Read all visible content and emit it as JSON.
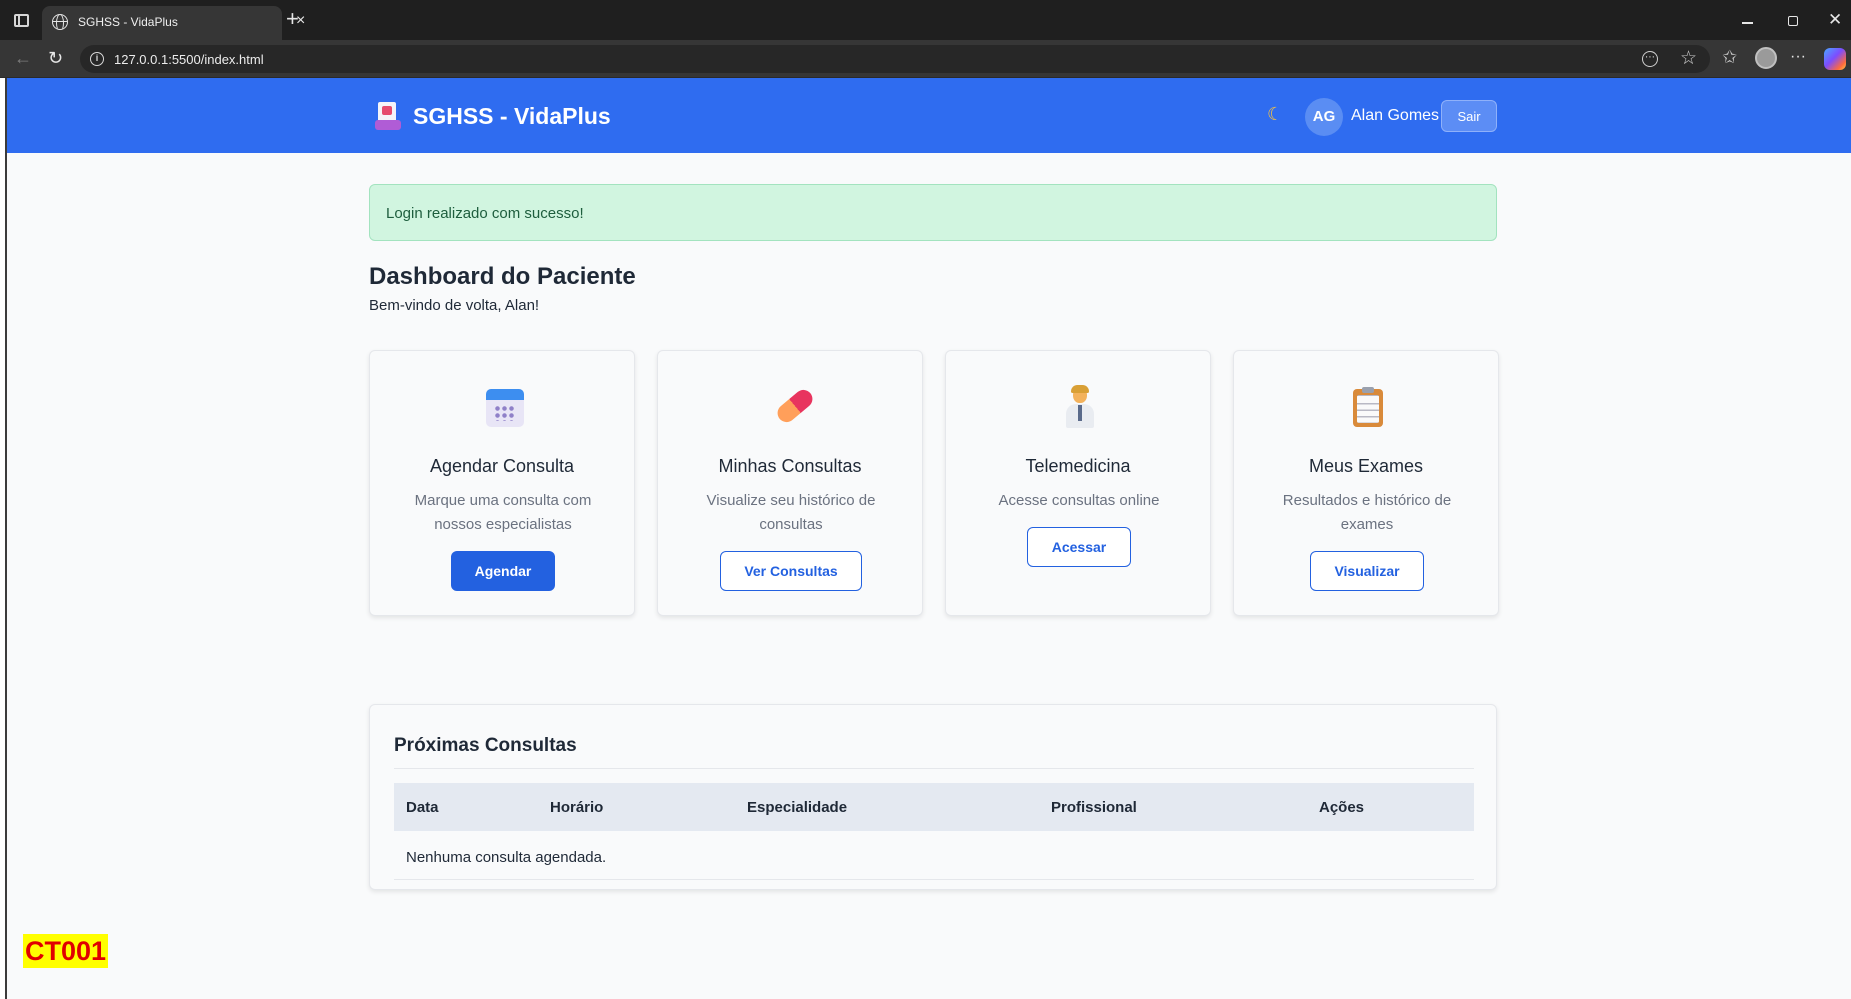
{
  "browser": {
    "tab_title": "SGHSS - VidaPlus",
    "tab_close": "×",
    "new_tab": "+",
    "url": "127.0.0.1:5500/index.html"
  },
  "header": {
    "brand": "SGHSS - VidaPlus",
    "theme_icon": "☾",
    "avatar_initials": "AG",
    "user_name": "Alan Gomes",
    "logout_label": "Sair"
  },
  "alert": {
    "message": "Login realizado com sucesso!"
  },
  "dashboard": {
    "title": "Dashboard do Paciente",
    "subtitle": "Bem-vindo de volta, Alan!"
  },
  "cards": [
    {
      "icon": "calendar-icon",
      "title": "Agendar Consulta",
      "description": "Marque uma consulta com nossos especialistas",
      "button": "Agendar"
    },
    {
      "icon": "pill-icon",
      "title": "Minhas Consultas",
      "description": "Visualize seu histórico de consultas",
      "button": "Ver Consultas"
    },
    {
      "icon": "doctor-icon",
      "title": "Telemedicina",
      "description": "Acesse consultas online",
      "button": "Acessar"
    },
    {
      "icon": "clipboard-icon",
      "title": "Meus Exames",
      "description": "Resultados e histórico de exames",
      "button": "Visualizar"
    }
  ],
  "appointments": {
    "title": "Próximas Consultas",
    "columns": [
      "Data",
      "Horário",
      "Especialidade",
      "Profissional",
      "Ações"
    ],
    "empty_message": "Nenhuma consulta agendada."
  },
  "annotation": {
    "label": "CT001"
  },
  "colors": {
    "header_bg": "#2f6cf0",
    "primary": "#2361e0",
    "alert_bg": "#d1f5e0",
    "table_header_bg": "#e4e9f1"
  }
}
